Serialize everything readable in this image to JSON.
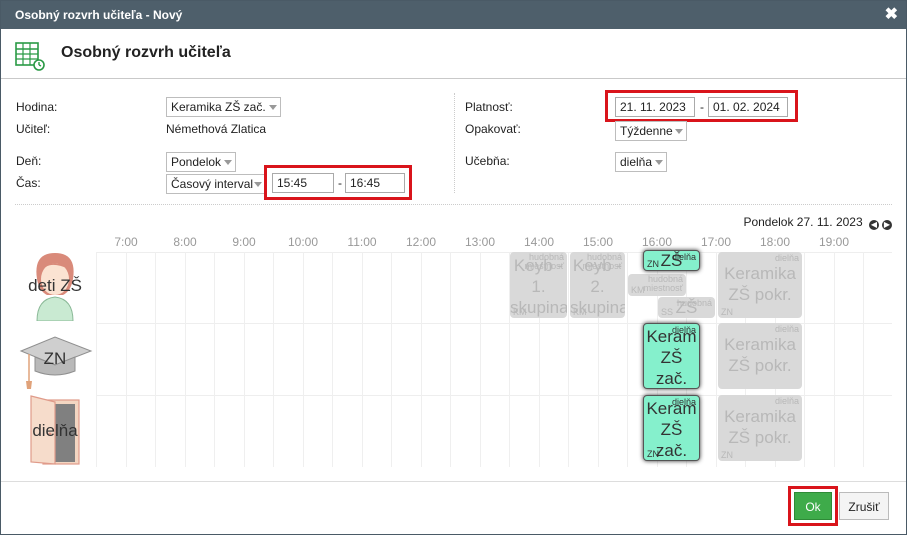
{
  "window": {
    "title": "Osobný rozvrh učiteľa - Nový",
    "close_glyph": "✖"
  },
  "header": {
    "title": "Osobný rozvrh učiteľa",
    "icon": "calendar-table-icon"
  },
  "form": {
    "hodina_label": "Hodina:",
    "hodina_value": "Keramika ZŠ zač.",
    "ucitel_label": "Učiteľ:",
    "ucitel_value": "Némethová Zlatica",
    "den_label": "Deň:",
    "den_value": "Pondelok",
    "cas_label": "Čas:",
    "cas_mode": "Časový interval",
    "cas_from": "15:45",
    "cas_to": "16:45",
    "platnost_label": "Platnosť:",
    "platnost_from": "21. 11. 2023",
    "platnost_to": "01. 02. 2024",
    "opakovat_label": "Opakovať:",
    "opakovat_value": "Týždenne",
    "ucebna_label": "Učebňa:",
    "ucebna_value": "dielňa",
    "dash": "-"
  },
  "schedule": {
    "date_label": "Pondelok 27. 11. 2023",
    "prev_glyph": "◀",
    "next_glyph": "▶",
    "times": [
      "7:00",
      "8:00",
      "9:00",
      "10:00",
      "11:00",
      "12:00",
      "13:00",
      "14:00",
      "15:00",
      "16:00",
      "17:00",
      "18:00",
      "19:00"
    ],
    "rows": [
      {
        "label": "deti ZŠ",
        "icon": "child-avatar-icon"
      },
      {
        "label": "ZN",
        "icon": "graduation-cap-icon"
      },
      {
        "label": "dielňa",
        "icon": "door-icon"
      }
    ],
    "events": {
      "r1_keyb1": {
        "big": "Keyb -\n1.\nskupina",
        "room": "hudobná\nmiestnosť",
        "tag": "KM"
      },
      "r1_keyb2": {
        "big": "Keyb -\n2.\nskupina",
        "room": "hudobná\nmiestnosť",
        "tag": "KM"
      },
      "r1_green": {
        "big": "ZŠ",
        "room": "dielňa",
        "tag": "ZN"
      },
      "r1_small1": {
        "room": "hudobná\nmiestnosť",
        "tag": "KM"
      },
      "r1_small2": {
        "big": "ZŠ",
        "room": "hudobná",
        "tag": "SS"
      },
      "r1_keramika_pokr": {
        "big": "Keramika\nZŠ pokr.",
        "room": "dielňa",
        "tag": "ZN"
      },
      "r2_green": {
        "big": "Keram\nZŠ\nzač.",
        "room": "dielňa",
        "tag": ""
      },
      "r2_keramika_pokr": {
        "big": "Keramika\nZŠ pokr.",
        "room": "dielňa",
        "tag": ""
      },
      "r3_green": {
        "big": "Keram\nZŠ\nzač.",
        "room": "dielňa",
        "tag": "ZN"
      },
      "r3_keramika_pokr": {
        "big": "Keramika\nZŠ pokr.",
        "room": "dielňa",
        "tag": "ZN"
      }
    }
  },
  "footer": {
    "ok_label": "Ok",
    "cancel_label": "Zrušiť"
  },
  "colors": {
    "titlebar": "#4e5f6b",
    "highlight": "#d9141b",
    "ok": "#3eab4a",
    "event_green": "#85f0cc",
    "event_gray": "#d9d9d9"
  }
}
